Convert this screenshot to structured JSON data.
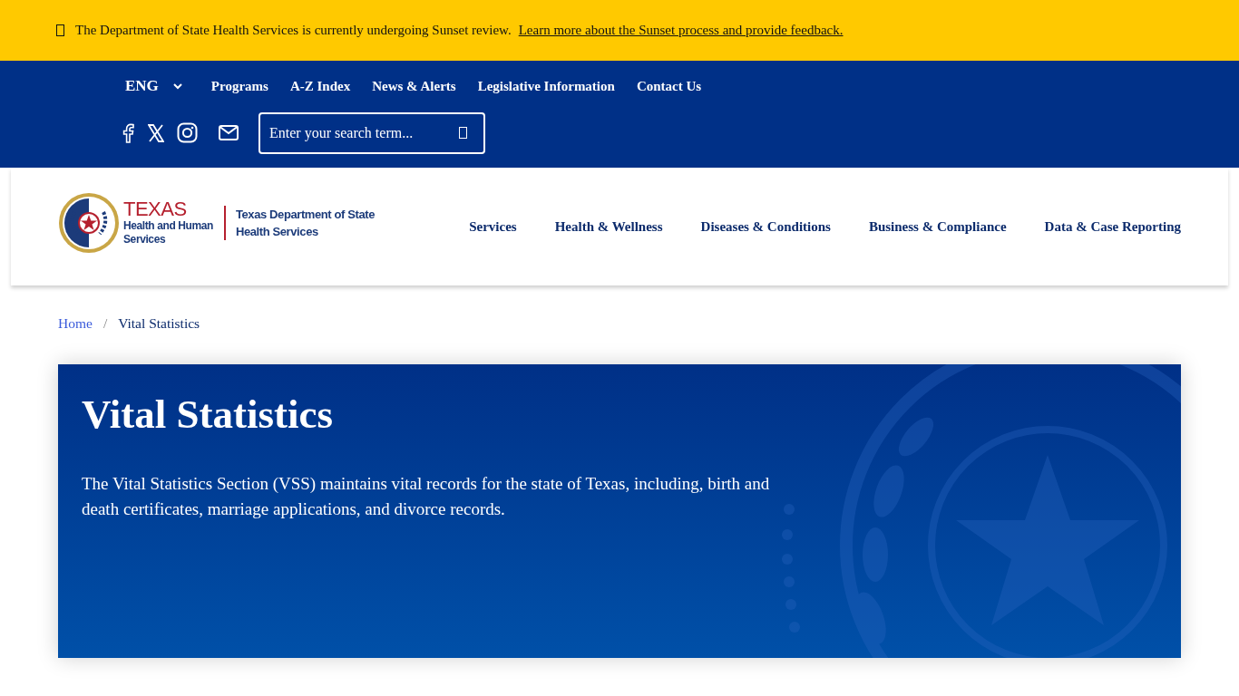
{
  "alert": {
    "text": "The Department of State Health Services is currently undergoing Sunset review.",
    "link": "Learn more about the Sunset process and provide feedback."
  },
  "utility_nav": {
    "language": "ENG",
    "links": [
      "Programs",
      "A-Z Index",
      "News & Alerts",
      "Legislative Information",
      "Contact Us"
    ]
  },
  "search": {
    "placeholder": "Enter your search term..."
  },
  "logo": {
    "state": "TEXAS",
    "agency_lines": [
      "Health and Human",
      "Services"
    ],
    "department_lines": [
      "Texas Department of State",
      "Health Services"
    ]
  },
  "main_nav": [
    "Services",
    "Health & Wellness",
    "Diseases & Conditions",
    "Business & Compliance",
    "Data & Case Reporting"
  ],
  "breadcrumb_separator": "/",
  "breadcrumb": [
    {
      "label": "Home",
      "current": false
    },
    {
      "label": "Vital Statistics",
      "current": true
    }
  ],
  "hero": {
    "title": "Vital Statistics",
    "description": "The Vital Statistics Section (VSS) maintains vital records for the state of Texas, including, birth and death certificates, marriage applications, and divorce records."
  }
}
